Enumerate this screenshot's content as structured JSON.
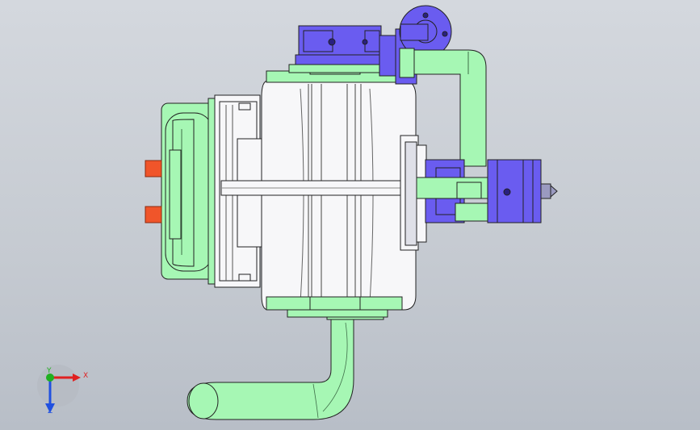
{
  "viewport": {
    "background_top": "#d4d8de",
    "background_bottom": "#b8bec7"
  },
  "model": {
    "colors": {
      "green": "#a6f7b4",
      "green_dark": "#3f6f49",
      "white_body": "#f7f7f9",
      "blue_violet": "#6a5cf0",
      "blue_violet_dark": "#2a2080",
      "orange": "#f0552a",
      "outline": "#222222"
    }
  },
  "triad": {
    "x_label": "X",
    "y_label": "Y",
    "z_label": "Z",
    "x_color": "#e02020",
    "y_color": "#20b020",
    "z_color": "#2050e0"
  }
}
